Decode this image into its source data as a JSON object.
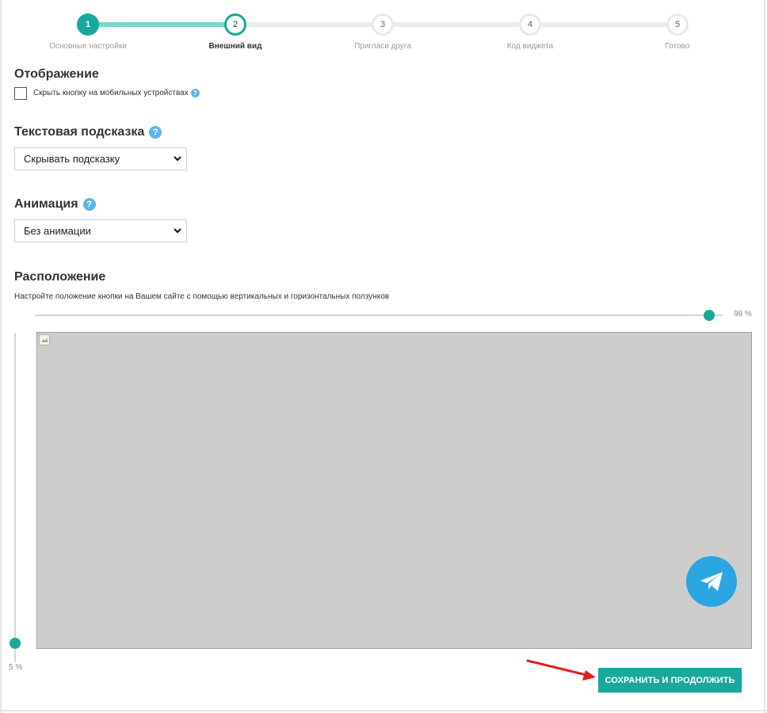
{
  "stepper": {
    "steps": [
      {
        "number": "1",
        "label": "Основные настройки",
        "state": "done"
      },
      {
        "number": "2",
        "label": "Внешний вид",
        "state": "current"
      },
      {
        "number": "3",
        "label": "Пригласи друга",
        "state": "todo"
      },
      {
        "number": "4",
        "label": "Код виджета",
        "state": "todo"
      },
      {
        "number": "5",
        "label": "Готово",
        "state": "todo"
      }
    ]
  },
  "display": {
    "title": "Отображение",
    "checkbox_label": "Скрыть кнопку на мобильных устройствах",
    "checkbox_checked": false
  },
  "tooltip": {
    "title": "Текстовая подсказка",
    "select_value": "Скрывать подсказку"
  },
  "animation": {
    "title": "Анимация",
    "select_value": "Без анимации"
  },
  "position": {
    "title": "Расположение",
    "description": "Настройте положение кнопки на Вашем сайте с помощью вертикальных и горизонтальных ползунков",
    "horizontal_value": "98 %",
    "vertical_value": "5 %",
    "horizontal_percent": 98,
    "vertical_percent": 5
  },
  "preview": {
    "button_icon": "telegram-icon",
    "button_color": "#2ca6e0"
  },
  "actions": {
    "save_label": "СОХРАНИТЬ И ПРОДОЛЖИТЬ"
  },
  "colors": {
    "accent": "#17a99b",
    "help": "#5bb6e8",
    "arrow": "#e02020"
  },
  "help_icon_glyph": "?"
}
